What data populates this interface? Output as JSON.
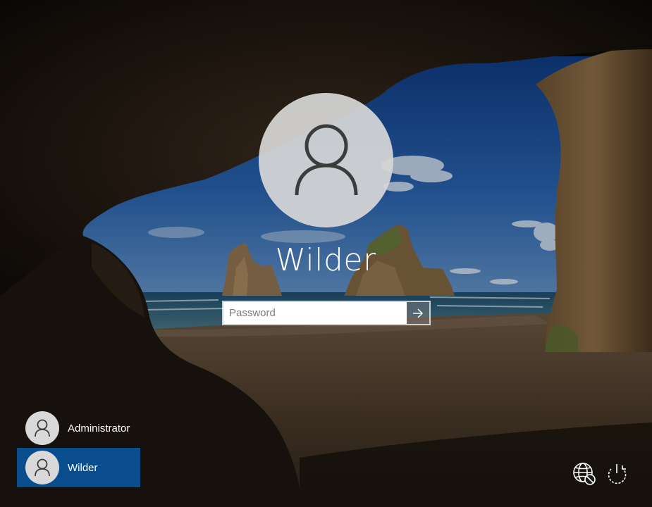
{
  "lock_screen": {
    "current_user": "Wilder",
    "password_placeholder": "Password"
  },
  "user_list": [
    {
      "name": "Administrator",
      "selected": false
    },
    {
      "name": "Wilder",
      "selected": true
    }
  ],
  "icons": {
    "user_avatar": "person-icon",
    "submit": "arrow-right-icon",
    "network": "globe-network-icon",
    "power": "power-icon"
  },
  "colors": {
    "selected_tile": "#0a4d8c",
    "avatar_background": "#d6d6d6",
    "text": "#ffffff"
  }
}
